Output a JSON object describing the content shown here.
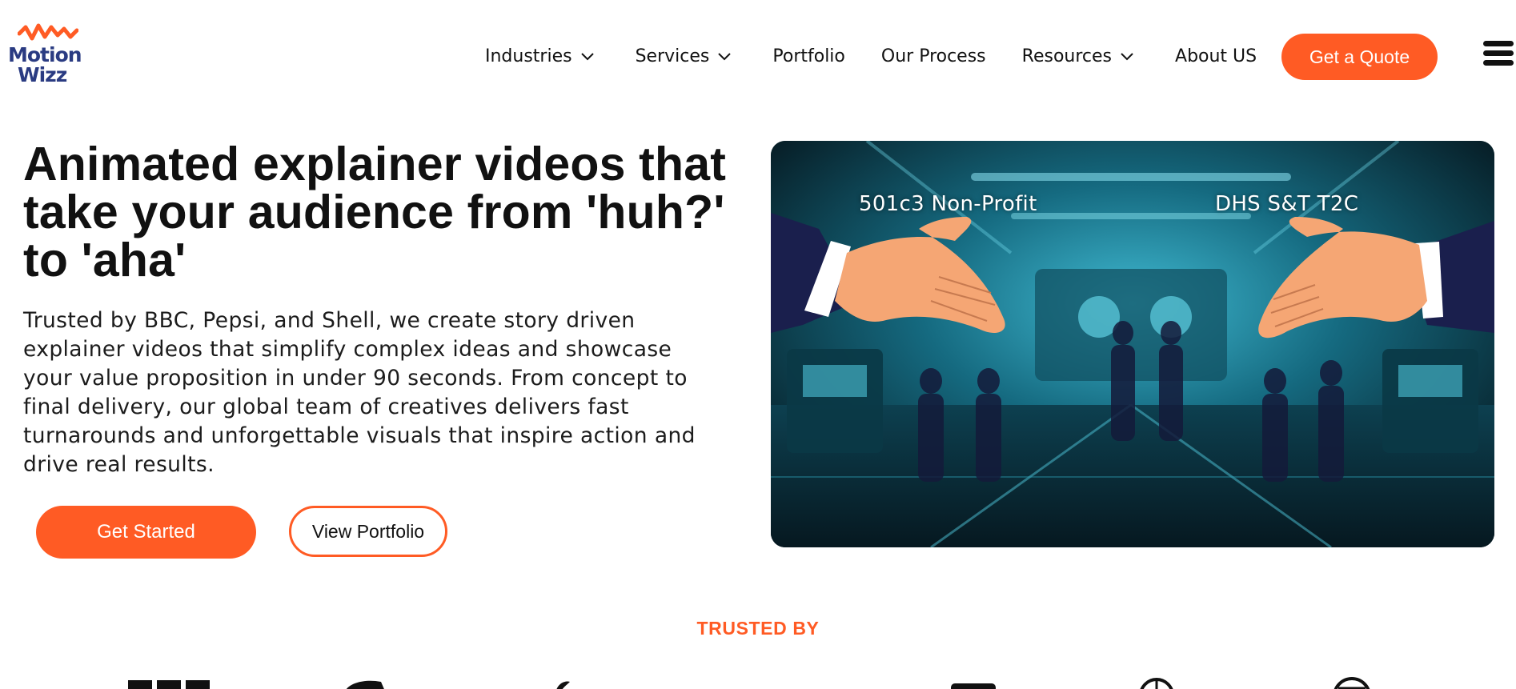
{
  "brand": {
    "name_line1": "Motion",
    "name_line2": "Wizz",
    "accent_color": "#ff5b24",
    "logo_color": "#2a3b82"
  },
  "nav": {
    "items": [
      {
        "label": "Industries",
        "has_dropdown": true
      },
      {
        "label": "Services",
        "has_dropdown": true
      },
      {
        "label": "Portfolio",
        "has_dropdown": false
      },
      {
        "label": "Our Process",
        "has_dropdown": false
      },
      {
        "label": "Resources",
        "has_dropdown": true
      },
      {
        "label": "About US",
        "has_dropdown": false
      }
    ],
    "cta_label": "Get a Quote",
    "menu_icon": "hamburger-menu-icon"
  },
  "hero": {
    "title": "Animated explainer videos that take your audience from 'huh?' to 'aha'",
    "description": "Trusted by BBC, Pepsi, and Shell, we create story driven explainer videos that simplify complex ideas and showcase your value proposition in under 90 seconds. From concept to final delivery, our global team of creatives delivers fast turnarounds and unforgettable visuals that inspire action and drive real results.",
    "primary_cta": "Get Started",
    "secondary_cta": "View Portfolio",
    "image": {
      "label_left": "501c3 Non-Profit",
      "label_right": "DHS S&T T2C"
    }
  },
  "trusted": {
    "heading": "TRUSTED BY"
  }
}
